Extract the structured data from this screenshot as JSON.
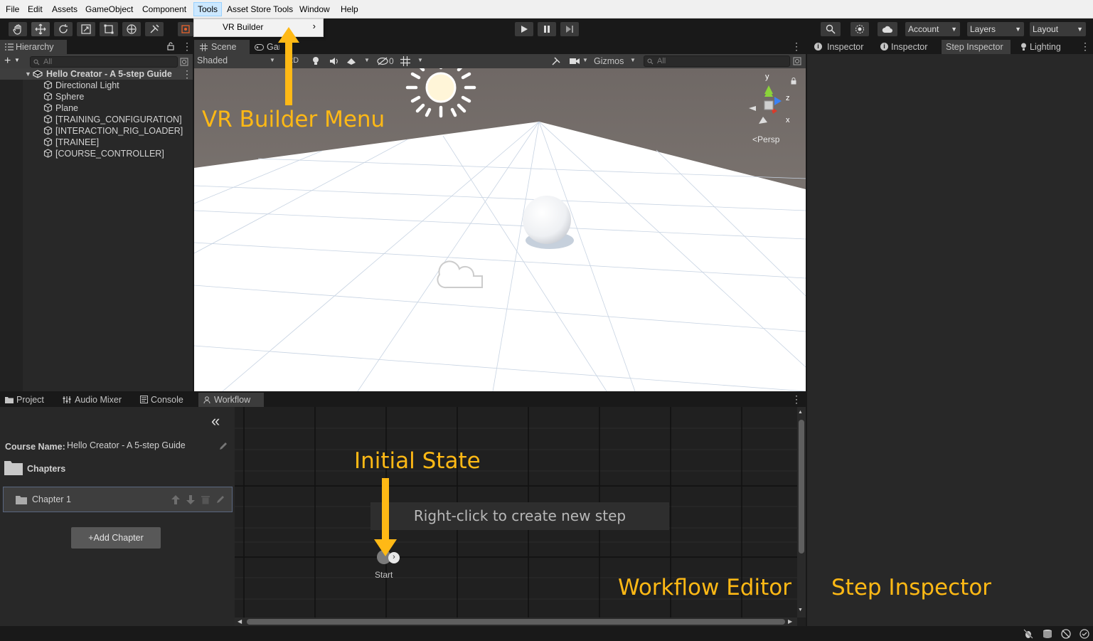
{
  "menubar": {
    "items": [
      "File",
      "Edit",
      "Assets",
      "GameObject",
      "Component",
      "Tools",
      "Asset Store Tools",
      "Window",
      "Help"
    ],
    "active": "Tools"
  },
  "dropdown": {
    "item": "VR Builder"
  },
  "toolbar": {
    "account_label": "Account",
    "layers_label": "Layers",
    "layout_label": "Layout"
  },
  "hierarchy": {
    "tab_label": "Hierarchy",
    "search_placeholder": "All",
    "scene_name": "Hello Creator - A 5-step Guide",
    "items": [
      "Directional Light",
      "Sphere",
      "Plane",
      "[TRAINING_CONFIGURATION]",
      "[INTERACTION_RIG_LOADER]",
      "[TRAINEE]",
      "[COURSE_CONTROLLER]"
    ]
  },
  "scene": {
    "tabs": [
      "Scene",
      "Game"
    ],
    "shading_mode": "Shaded",
    "toggle_2d": "2D",
    "hidden_count": "0",
    "gizmos_label": "Gizmos",
    "search_placeholder": "All",
    "projection_label": "Persp",
    "axis_labels": {
      "y": "y",
      "z": "z",
      "x": "x"
    }
  },
  "inspector": {
    "tabs": [
      "Inspector",
      "Inspector",
      "Step Inspector",
      "Lighting"
    ],
    "selected_tab": "Step Inspector"
  },
  "bottom": {
    "tabs": [
      "Project",
      "Audio Mixer",
      "Console",
      "Workflow"
    ],
    "selected_tab": "Workflow",
    "course_name_label": "Course Name:",
    "course_name_value": "Hello Creator - A 5-step Guide",
    "chapters_label": "Chapters",
    "chapter_items": [
      "Chapter 1"
    ],
    "add_chapter_label": "+Add Chapter",
    "canvas_hint": "Right-click to create new step",
    "start_node_label": "Start"
  },
  "annotations": {
    "vr_builder_menu": "VR Builder Menu",
    "initial_state": "Initial State",
    "workflow_editor": "Workflow Editor",
    "step_inspector": "Step Inspector"
  },
  "colors": {
    "annotation": "#ffb915",
    "menubar_bg": "#f0f0f0",
    "panel_bg": "#282828",
    "sky": "#7b746f"
  }
}
